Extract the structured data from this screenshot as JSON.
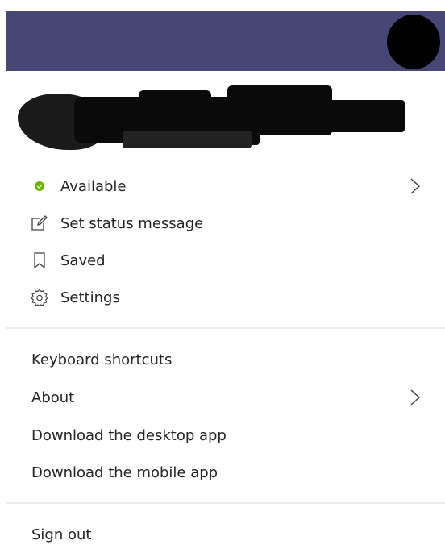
{
  "header": {
    "brand_color": "#464775"
  },
  "status_section": {
    "items": [
      {
        "label": "Available",
        "icon": "available-status-icon",
        "has_submenu": true
      },
      {
        "label": "Set status message",
        "icon": "edit-message-icon",
        "has_submenu": false
      },
      {
        "label": "Saved",
        "icon": "bookmark-icon",
        "has_submenu": false
      },
      {
        "label": "Settings",
        "icon": "gear-icon",
        "has_submenu": false
      }
    ]
  },
  "help_section": {
    "items": [
      {
        "label": "Keyboard shortcuts",
        "has_submenu": false
      },
      {
        "label": "About",
        "has_submenu": true
      },
      {
        "label": "Download the desktop app",
        "has_submenu": false
      },
      {
        "label": "Download the mobile app",
        "has_submenu": false
      }
    ]
  },
  "footer": {
    "sign_out_label": "Sign out"
  },
  "colors": {
    "available_green": "#6bb700",
    "text": "#252423",
    "icon": "#424242"
  }
}
